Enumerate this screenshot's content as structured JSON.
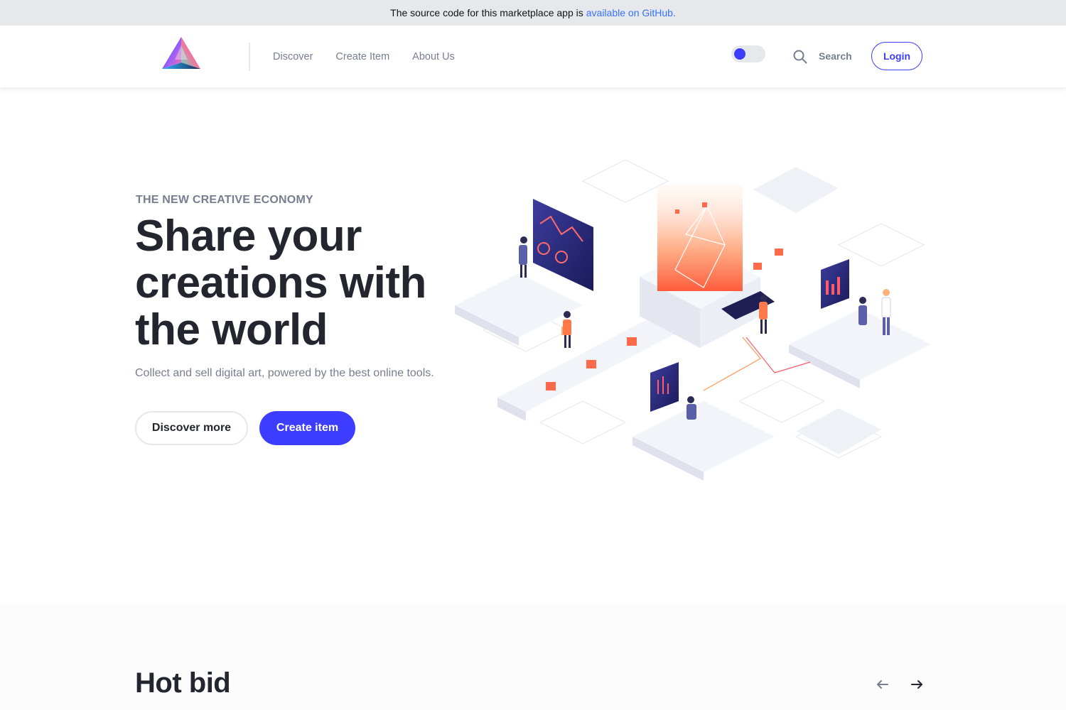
{
  "banner": {
    "text": "The source code for this marketplace app is",
    "link_text": "available on GitHub",
    "suffix": "."
  },
  "header": {
    "logo": "prism-triangle-logo",
    "nav": [
      "Discover",
      "Create Item",
      "About Us"
    ],
    "search_label": "Search",
    "login_label": "Login",
    "theme_toggle": "dark-mode-toggle"
  },
  "hero": {
    "eyebrow": "THE NEW CREATIVE ECONOMY",
    "title": "Share your creations with the world",
    "subtitle": "Collect and sell digital art, powered by the best online tools.",
    "discover_label": "Discover more",
    "create_label": "Create item"
  },
  "hot_bid": {
    "title": "Hot bid"
  },
  "icons": {
    "search": "search-icon",
    "prev": "arrow-left-icon",
    "next": "arrow-right-icon"
  },
  "colors": {
    "accent": "#3d3dff",
    "link": "#3772ff",
    "text_dark": "#23262f",
    "text_muted": "#777e90",
    "banner_bg": "#e6e8ec",
    "section_bg": "#fcfcfd"
  }
}
